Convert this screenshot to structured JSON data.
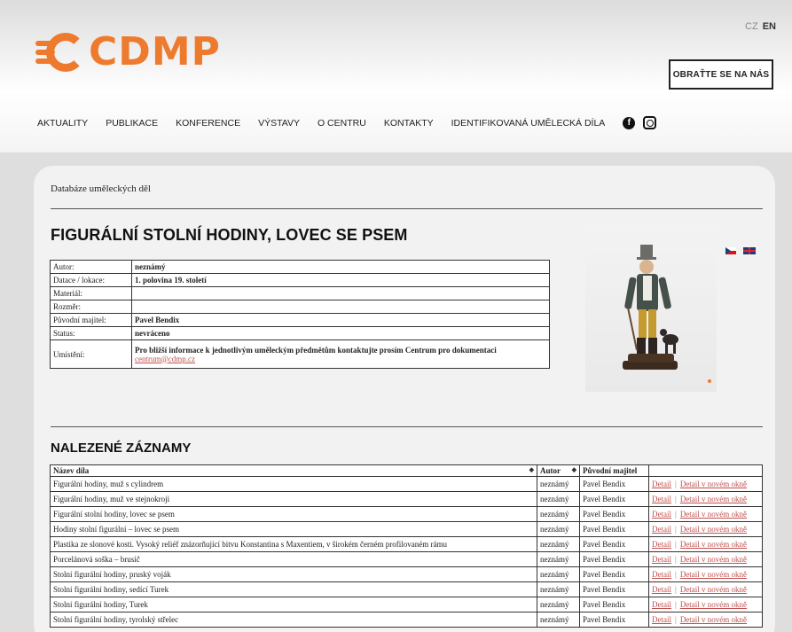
{
  "header": {
    "logo_text": "CDMP",
    "lang": {
      "cz": "CZ",
      "en": "EN"
    },
    "contact_button": "OBRAŤTE SE NA NÁS",
    "nav": [
      "AKTUALITY",
      "PUBLIKACE",
      "KONFERENCE",
      "VÝSTAVY",
      "O CENTRU",
      "KONTAKTY",
      "IDENTIFIKOVANÁ UMĚLECKÁ DÍLA"
    ],
    "facebook_glyph": "f"
  },
  "breadcrumb": "Databáze uměleckých děl",
  "item": {
    "title": "FIGURÁLNÍ STOLNÍ HODINY, LOVEC SE PSEM",
    "rows": [
      {
        "key": "Autor:",
        "value": "neznámý"
      },
      {
        "key": "Datace / lokace:",
        "value": "1. polovina 19. století"
      },
      {
        "key": "Materiál:",
        "value": ""
      },
      {
        "key": "Rozměr:",
        "value": ""
      },
      {
        "key": "Původní majitel:",
        "value": "Pavel Bendix"
      },
      {
        "key": "Status:",
        "value": "nevráceno"
      }
    ],
    "location_key": "Umístění:",
    "location_text": "Pro bližší informace k jednotlivým uměleckým předmětům kontaktujte prosím Centrum pro dokumentaci",
    "location_email": "centrum@cdmp.cz"
  },
  "results": {
    "title": "NALEZENÉ ZÁZNAMY",
    "columns": [
      "Název díla",
      "Autor",
      "Původní majitel"
    ],
    "detail_label": "Detail",
    "detail_new_label": "Detail v novém okně",
    "rows": [
      {
        "name": "Figurální hodiny, muž s cylindrem",
        "author": "neznámý",
        "owner": "Pavel Bendix"
      },
      {
        "name": "Figurální hodiny, muž ve stejnokroji",
        "author": "neznámý",
        "owner": "Pavel Bendix"
      },
      {
        "name": "Figurální stolní hodiny, lovec se psem",
        "author": "neznámý",
        "owner": "Pavel Bendix"
      },
      {
        "name": "Hodiny stolní figurální – lovec se psem",
        "author": "neznámý",
        "owner": "Pavel Bendix"
      },
      {
        "name": "Plastika ze slonové kosti. Vysoký reliéf znázorňující bitvu Konstantina s Maxentiem, v širokém černém profilovaném rámu",
        "author": "neznámý",
        "owner": "Pavel Bendix"
      },
      {
        "name": "Porcelánová soška – brusič",
        "author": "neznámý",
        "owner": "Pavel Bendix"
      },
      {
        "name": "Stolní figurální hodiny, pruský voják",
        "author": "neznámý",
        "owner": "Pavel Bendix"
      },
      {
        "name": "Stolní figurální hodiny, sedící Turek",
        "author": "neznámý",
        "owner": "Pavel Bendix"
      },
      {
        "name": "Stolní figurální hodiny, Turek",
        "author": "neznámý",
        "owner": "Pavel Bendix"
      },
      {
        "name": "Stolní figurální hodiny, tyrolský střelec",
        "author": "neznámý",
        "owner": "Pavel Bendix"
      }
    ]
  },
  "colors": {
    "brand": "#ee7a2e",
    "link": "#c0504d"
  }
}
